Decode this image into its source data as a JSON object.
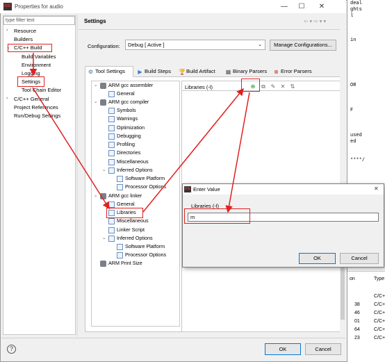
{
  "background_editor": {
    "code_lines": [
      "deal",
      "ghts",
      "l",
      "in",
      "OR",
      "F",
      "used",
      "ed",
      "****/"
    ],
    "table_headers": [
      "on",
      "Type"
    ],
    "table_rows": [
      [
        "",
        "C/C+"
      ],
      [
        "38",
        "C/C+"
      ],
      [
        "46",
        "C/C+"
      ],
      [
        "01",
        "C/C+"
      ],
      [
        "64",
        "C/C+"
      ],
      [
        "23",
        "C/C+"
      ]
    ]
  },
  "window": {
    "title": "Properties for audio",
    "minimize_glyph": "—",
    "maximize_glyph": "☐",
    "close_glyph": "✕"
  },
  "left_nav": {
    "filter_placeholder": "type filter text",
    "items": [
      {
        "label": "Resource",
        "twisty": "›"
      },
      {
        "label": "Builders",
        "twisty": ""
      },
      {
        "label": "C/C++ Build",
        "twisty": "⌄"
      },
      {
        "label": "Build Variables",
        "twisty": ""
      },
      {
        "label": "Environment",
        "twisty": ""
      },
      {
        "label": "Logging",
        "twisty": ""
      },
      {
        "label": "Settings",
        "twisty": ""
      },
      {
        "label": "Tool Chain Editor",
        "twisty": ""
      },
      {
        "label": "C/C++ General",
        "twisty": "›"
      },
      {
        "label": "Project References",
        "twisty": ""
      },
      {
        "label": "Run/Debug Settings",
        "twisty": ""
      }
    ]
  },
  "header": {
    "title": "Settings",
    "nav_glyphs": "⇦ ▾ ⇨ ▾ ▾"
  },
  "configuration": {
    "label": "Configuration:",
    "value": "Debug  [ Active ]",
    "manage_button": "Manage Configurations..."
  },
  "tabs": [
    {
      "label": "Tool Settings",
      "icon": "⚙",
      "icon_color": "#4a6fa5",
      "active": true
    },
    {
      "label": "Build Steps",
      "icon": "▶",
      "icon_color": "#3a7bd5",
      "active": false
    },
    {
      "label": "Build Artifact",
      "icon": "🏆",
      "icon_color": "#d9a400",
      "active": false
    },
    {
      "label": "Binary Parsers",
      "icon": "▦",
      "icon_color": "#555555",
      "active": false
    },
    {
      "label": "Error Parsers",
      "icon": "⊗",
      "icon_color": "#d03030",
      "active": false
    }
  ],
  "tool_tree": [
    {
      "label": "ARM gcc assembler",
      "twisty": "⌄",
      "icon": "cfg"
    },
    {
      "label": "General",
      "twisty": "",
      "icon": "opt"
    },
    {
      "label": "ARM gcc compiler",
      "twisty": "⌄",
      "icon": "cfg"
    },
    {
      "label": "Symbols",
      "twisty": "",
      "icon": "opt"
    },
    {
      "label": "Warnings",
      "twisty": "",
      "icon": "opt"
    },
    {
      "label": "Optimization",
      "twisty": "",
      "icon": "opt"
    },
    {
      "label": "Debugging",
      "twisty": "",
      "icon": "opt"
    },
    {
      "label": "Profiling",
      "twisty": "",
      "icon": "opt"
    },
    {
      "label": "Directories",
      "twisty": "",
      "icon": "opt"
    },
    {
      "label": "Miscellaneous",
      "twisty": "",
      "icon": "opt"
    },
    {
      "label": "Inferred Options",
      "twisty": "⌄",
      "icon": "opt"
    },
    {
      "label": "Software Platform",
      "twisty": "",
      "icon": "opt"
    },
    {
      "label": "Processor Options",
      "twisty": "",
      "icon": "opt"
    },
    {
      "label": "ARM gcc linker",
      "twisty": "⌄",
      "icon": "cfg"
    },
    {
      "label": "General",
      "twisty": "",
      "icon": "opt"
    },
    {
      "label": "Libraries",
      "twisty": "",
      "icon": "opt"
    },
    {
      "label": "Miscellaneous",
      "twisty": "",
      "icon": "opt"
    },
    {
      "label": "Linker Script",
      "twisty": "",
      "icon": "opt"
    },
    {
      "label": "Inferred Options",
      "twisty": "⌄",
      "icon": "opt"
    },
    {
      "label": "Software Platform",
      "twisty": "",
      "icon": "opt"
    },
    {
      "label": "Processor Options",
      "twisty": "",
      "icon": "opt"
    },
    {
      "label": "ARM Print Size",
      "twisty": "",
      "icon": "cfg"
    }
  ],
  "libraries_panel": {
    "title": "Libraries (-l)",
    "toolbar_icons": [
      "⊕",
      "⧉",
      "✎",
      "✕",
      "⇅"
    ]
  },
  "enter_value_dialog": {
    "title": "Enter Value",
    "close_glyph": "✕",
    "field_label": "Libraries (-l)",
    "input_value": "m",
    "ok_label": "OK",
    "cancel_label": "Cancel"
  },
  "footer": {
    "help_glyph": "?",
    "ok_label": "OK",
    "cancel_label": "Cancel"
  },
  "annotation_color": "#e02020"
}
